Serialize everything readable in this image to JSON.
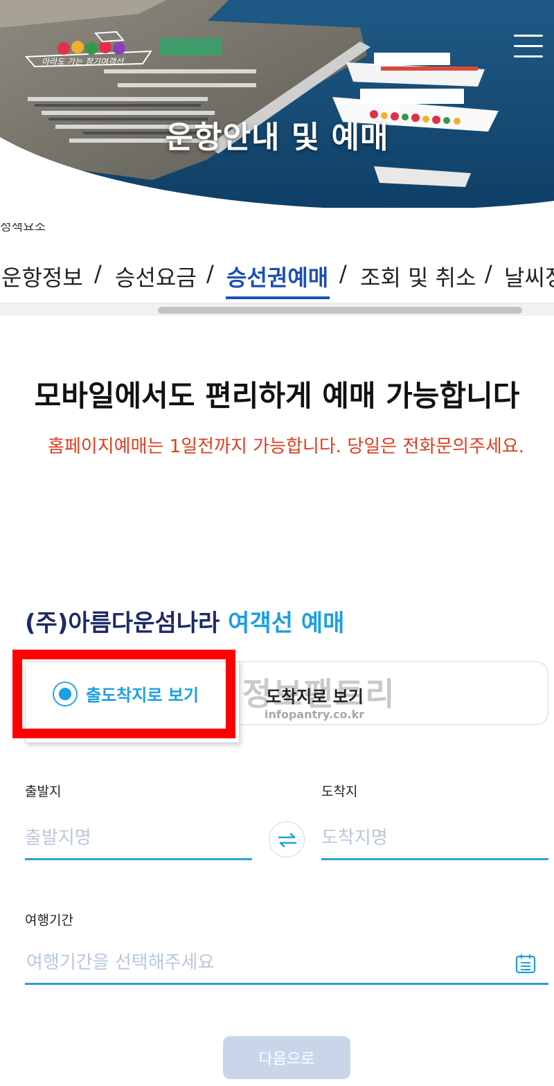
{
  "hero": {
    "title": "운항안내 및 예매",
    "logo_caption": "아라도 가는 정기여객선"
  },
  "broken_image_alt": "정책요소",
  "nav": {
    "items": [
      {
        "label": "운항정보",
        "active": false
      },
      {
        "label": "승선요금",
        "active": false
      },
      {
        "label": "승선권예매",
        "active": true
      },
      {
        "label": "조회 및 취소",
        "active": false
      },
      {
        "label": "날씨정보",
        "active": false
      }
    ],
    "separator": "/"
  },
  "headline": "모바일에서도 편리하게 예매 가능합니다",
  "notice": "홈페이지예매는 1일전까지 가능합니다. 당일은 전화문의주세요.",
  "company": {
    "name": "(주)아름다운섬나라",
    "accent": "여객선 예매"
  },
  "toggle": {
    "option_a": "출도착지로 보기",
    "option_b": "도착지로 보기",
    "selected": "option_a"
  },
  "watermark": {
    "text": "정보팬트리",
    "url": "infopantry.co.kr"
  },
  "form": {
    "departure_label": "출발지",
    "departure_placeholder": "출발지명",
    "arrival_label": "도착지",
    "arrival_placeholder": "도착지명",
    "period_label": "여행기간",
    "period_placeholder": "여행기간을 선택해주세요"
  },
  "next_button": "다음으로",
  "colors": {
    "primary_blue": "#1a4fb8",
    "accent_cyan": "#1a9fe3",
    "notice_red": "#e03c1e",
    "highlight_red": "#ff0000",
    "button_disabled": "#c9d6ea"
  },
  "icons": [
    "menu-icon",
    "swap-icon",
    "calendar-icon"
  ]
}
